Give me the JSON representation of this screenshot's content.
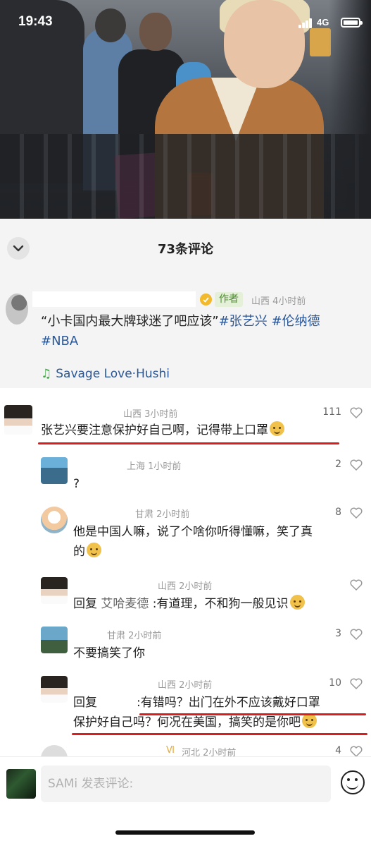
{
  "status_bar": {
    "time": "19:43",
    "network": "4G"
  },
  "header": {
    "comment_count_title": "73条评论"
  },
  "post": {
    "author_badge": "作者",
    "meta": "山西 4小时前",
    "text_quote": "“小卡国内最大牌球迷了吧应该”",
    "tags": [
      "#张艺兴",
      "#伦纳德",
      "#NBA"
    ],
    "music": "Savage Love·Hushi"
  },
  "comments": [
    {
      "meta": "山西 3小时前",
      "likes": "111",
      "text": "张艺兴要注意保护好自己啊，记得带上口罩"
    },
    {
      "meta": "上海 1小时前",
      "likes": "2",
      "text": "?"
    },
    {
      "meta": "甘肃 2小时前",
      "likes": "8",
      "text_line1": "他是中国人嘛，说了个啥你听得懂嘛，笑了真",
      "text_line2": "的"
    },
    {
      "meta": "山西 2小时前",
      "likes": "",
      "reply_prefix": "回复 ",
      "reply_name": "艾哈麦德",
      "text": " :有道理，不和狗一般见识"
    },
    {
      "meta": "甘肃 2小时前",
      "likes": "3",
      "text": "不要搞笑了你"
    },
    {
      "meta": "山西 2小时前",
      "likes": "10",
      "reply_prefix": "回复",
      "text_line1": ":有错吗？出门在外不应该戴好口罩",
      "text_line2": "保护好自己吗？何况在美国，搞笑的是你吧"
    },
    {
      "meta": "河北 2小时前",
      "likes": "4"
    }
  ],
  "input": {
    "placeholder": "SAMi 发表评论:"
  },
  "colors": {
    "tag_blue": "#2b5797",
    "underline_red": "#d81e1e",
    "badge_green": "#4d8b2f"
  }
}
